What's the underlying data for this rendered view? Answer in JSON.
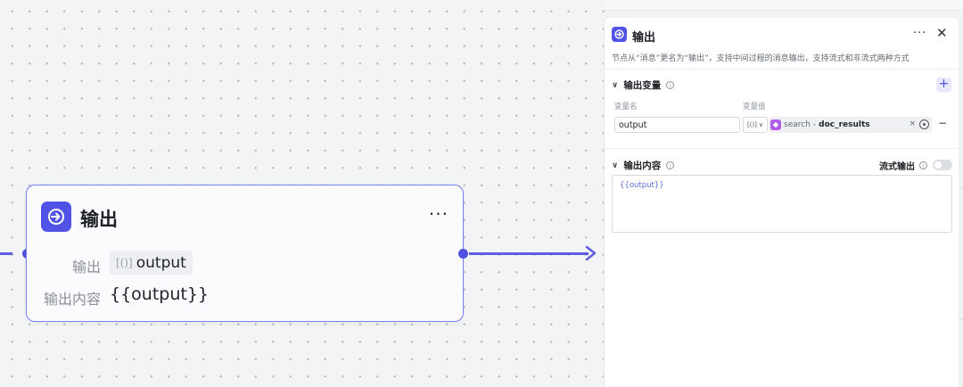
{
  "canvas": {
    "node": {
      "title": "输出",
      "more": "···",
      "output_label": "输出",
      "var_brace": "[()]",
      "var_name": "output",
      "content_label": "输出内容",
      "content_value": "{{output}}"
    }
  },
  "panel": {
    "title": "输出",
    "more": "···",
    "close": "✕",
    "description": "节点从“消息”更名为“输出”，支持中间过程的消息输出，支持流式和非流式两种方式",
    "variables_section": {
      "title": "输出变量",
      "add": "+",
      "col_name": "变量名",
      "col_value": "变量值",
      "row": {
        "name_value": "output",
        "type_label": "[()]",
        "source": "search",
        "separator": "-",
        "field": "doc_results",
        "clear": "×",
        "remove": "−"
      }
    },
    "content_section": {
      "title": "输出内容",
      "stream_label": "流式输出",
      "stream_enabled": false,
      "editor_value": "{{output}}"
    }
  },
  "colors": {
    "accent": "#5153e6",
    "node_border": "#7b7ef0",
    "edge": "#5b5ee0",
    "source_icon": "#b25ce8"
  }
}
